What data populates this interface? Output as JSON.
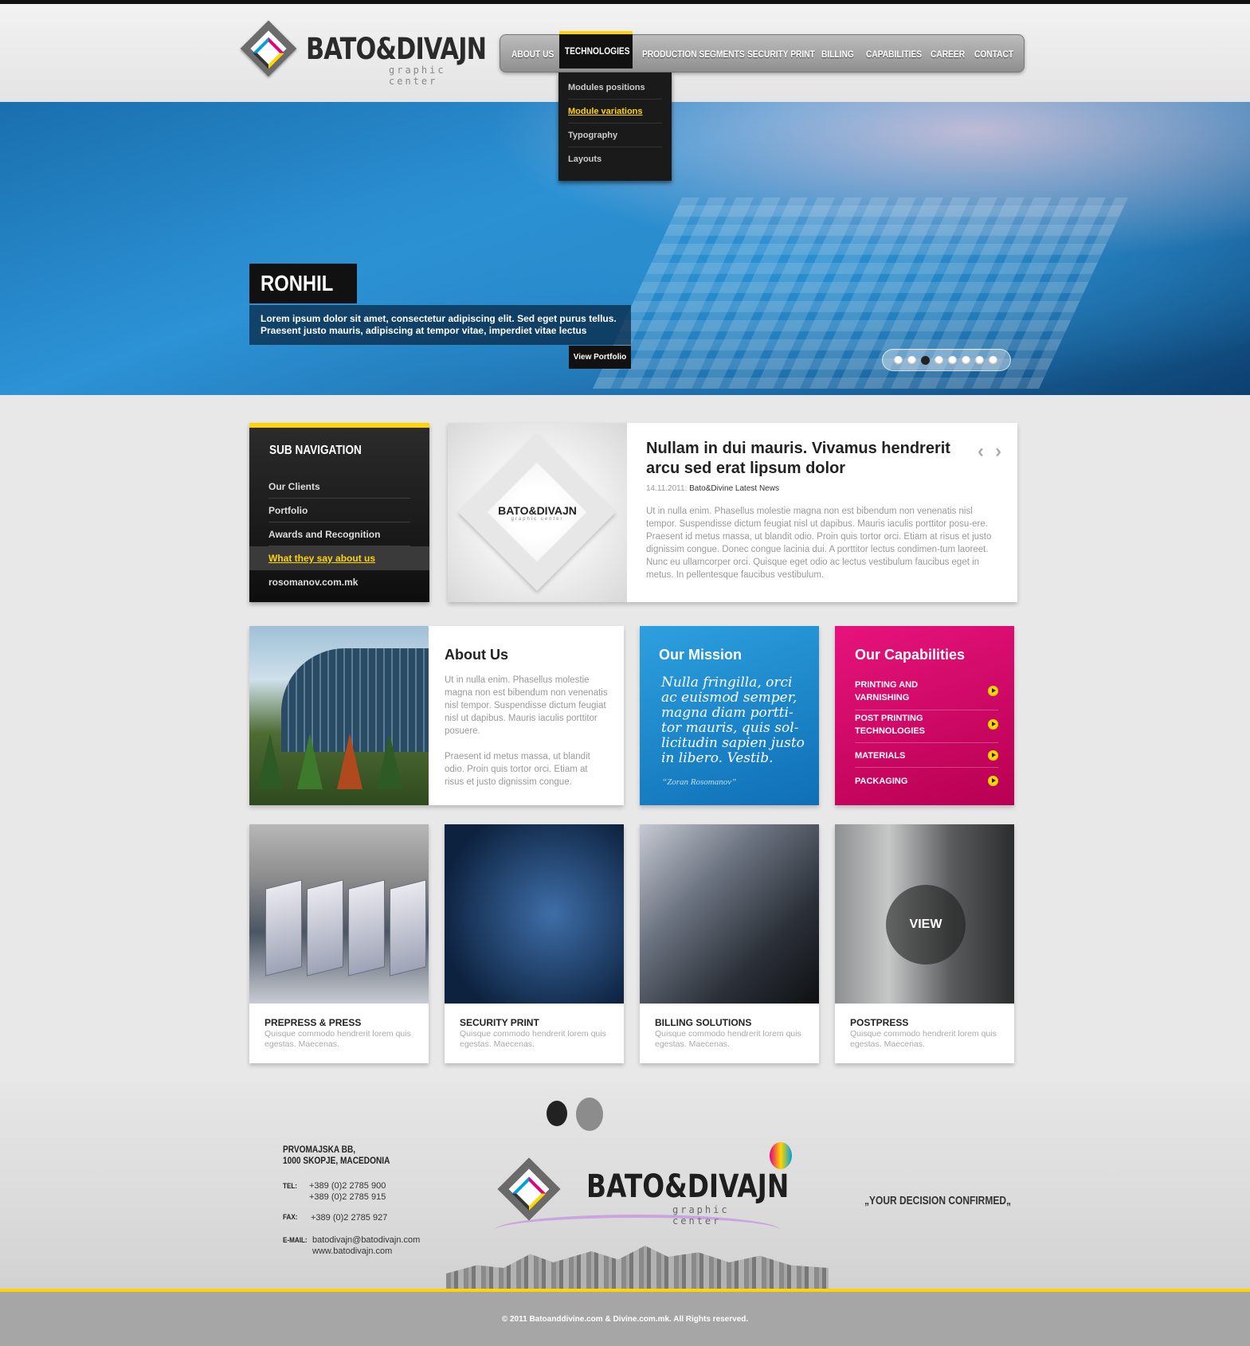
{
  "brand": {
    "name": "BATO&DIVAJN",
    "subtitle": "graphic center"
  },
  "nav": {
    "items": [
      "ABOUT US",
      "TECHNOLOGIES",
      "PRODUCTION SEGMENTS",
      "SECURITY PRINT",
      "BILLING",
      "CAPABILITIES",
      "CAREER",
      "CONTACT"
    ],
    "active": "TECHNOLOGIES",
    "dropdown": [
      "Modules positions",
      "Module variations",
      "Typography",
      "Layouts"
    ],
    "dropdown_active": "Module variations"
  },
  "hero": {
    "title": "RONHIL",
    "description": "Lorem ipsum dolor sit amet, consectetur adipiscing elit. Sed eget purus tellus. Praesent justo mauris, adipiscing at tempor vitae, imperdiet vitae lectus",
    "button": "View Portfolio",
    "slide_count": 8,
    "active_slide": 3
  },
  "subnav": {
    "title": "SUB NAVIGATION",
    "items": [
      "Our Clients",
      "Portfolio",
      "Awards and Recognition",
      "What they say about us",
      "rosomanov.com.mk"
    ],
    "active": "What they say about us"
  },
  "news": {
    "thumb_logo": "BATO&DIVAJN",
    "thumb_sub": "graphic center",
    "title": "Nullam in dui mauris. Vivamus hendrerit arcu sed erat lipsum dolor",
    "date": "14.11.2011:",
    "source": "Bato&Divine Latest News",
    "body": "Ut in nulla enim. Phasellus molestie magna non est bibendum non venenatis nisl tempor. Suspendisse dictum feugiat nisl ut dapibus. Mauris iaculis porttitor posu-ere. Praesent id metus massa, ut blandit odio. Proin quis tortor orci. Etiam at risus et justo dignissim congue. Donec congue lacinia dui. A porttitor lectus condimen-tum laoreet. Nunc eu ullamcorper orci. Quisque eget odio ac lectus vestibulum faucibus eget in metus. In pellentesque faucibus vestibulum."
  },
  "about": {
    "title": "About Us",
    "text": "Ut in nulla enim. Phasellus molestie magna non est bibendum non venenatis nisl tempor. Suspendisse dictum feugiat nisl ut dapibus. Mauris iaculis porttitor posuere.\n\nPraesent id metus massa, ut blandit odio. Proin quis tortor orci. Etiam at risus et justo dignissim congue."
  },
  "mission": {
    "title": "Our Mission",
    "quote": "Nulla fringilla, orci ac euismod semper, magna diam portti-tor mauris, quis sol-licitudin sapien justo in libero. Vestib.",
    "author": "“Zoran Rosomanov”"
  },
  "capabilities": {
    "title": "Our Capabilities",
    "items": [
      {
        "line1": "PRINTING AND",
        "line2": "VARNISHING"
      },
      {
        "line1": "POST PRINTING",
        "line2": "TECHNOLOGIES"
      },
      {
        "line1": "MATERIALS",
        "line2": ""
      },
      {
        "line1": "PACKAGING",
        "line2": ""
      }
    ]
  },
  "services": [
    {
      "title": "PREPRESS & PRESS",
      "desc": "Quisque commodo hendrerit lorem quis egestas. Maecenas."
    },
    {
      "title": "SECURITY PRINT",
      "desc": "Quisque commodo hendrerit lorem quis egestas. Maecenas."
    },
    {
      "title": "BILLING SOLUTIONS",
      "desc": "Quisque commodo hendrerit lorem quis egestas. Maecenas."
    },
    {
      "title": "POSTPRESS",
      "desc": "Quisque commodo hendrerit lorem quis egestas. Maecenas.",
      "overlay": "VIEW"
    }
  ],
  "footer": {
    "address_line1": "PRVOMAJSKA BB,",
    "address_line2": "1000 SKOPJE, MACEDONIA",
    "tel_label": "TEL:",
    "tel1": "+389 (0)2 2785 900",
    "tel2": "+389 (0)2 2785 915",
    "fax_label": "FAX:",
    "fax": "+389 (0)2 2785 927",
    "email_label": "E-MAIL:",
    "email": "batodivajn@batodivajn.com",
    "website": "www.batodivajn.com",
    "tagline": "YOUR DECISION CONFIRMED",
    "copyright": "© 2011 Batoanddivine.com & Divine.com.mk. All Rights reserved."
  },
  "colors": {
    "accent_yellow": "#ffd400",
    "mission_blue": "#1a86cf",
    "capabilities_magenta": "#d4086a"
  }
}
